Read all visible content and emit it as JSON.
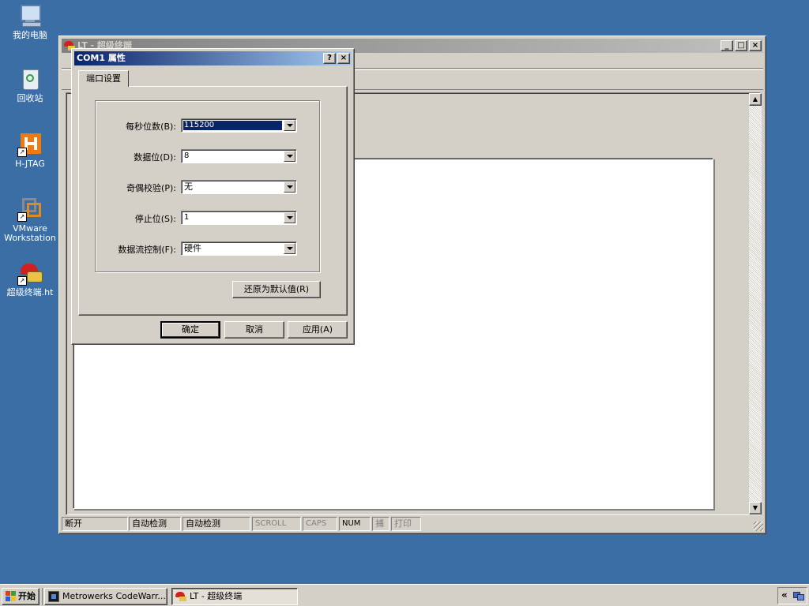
{
  "desktop": {
    "icons": [
      {
        "label": "我的电脑"
      },
      {
        "label": "回收站"
      },
      {
        "label": "H-JTAG"
      },
      {
        "label": "VMware Workstation"
      },
      {
        "label": "超级终端.ht"
      }
    ]
  },
  "main_window": {
    "title": "LT - 超级终端",
    "status": [
      "断开",
      "自动检测",
      "自动检测",
      "SCROLL",
      "CAPS",
      "NUM",
      "捕",
      "打印"
    ]
  },
  "dialog": {
    "title": "COM1 属性",
    "help_btn": "?",
    "close_btn": "×",
    "tab": "端口设置",
    "fields": [
      {
        "label": "每秒位数(B):",
        "value": "115200"
      },
      {
        "label": "数据位(D):",
        "value": "8"
      },
      {
        "label": "奇偶校验(P):",
        "value": "无"
      },
      {
        "label": "停止位(S):",
        "value": "1"
      },
      {
        "label": "数据流控制(F):",
        "value": "硬件"
      }
    ],
    "restore_btn": "还原为默认值(R)",
    "ok_btn": "确定",
    "cancel_btn": "取消",
    "apply_btn": "应用(A)"
  },
  "taskbar": {
    "start": "开始",
    "tasks": [
      {
        "label": "Metrowerks CodeWarr..."
      },
      {
        "label": "LT - 超级终端"
      }
    ],
    "tray_chevron": "«"
  }
}
